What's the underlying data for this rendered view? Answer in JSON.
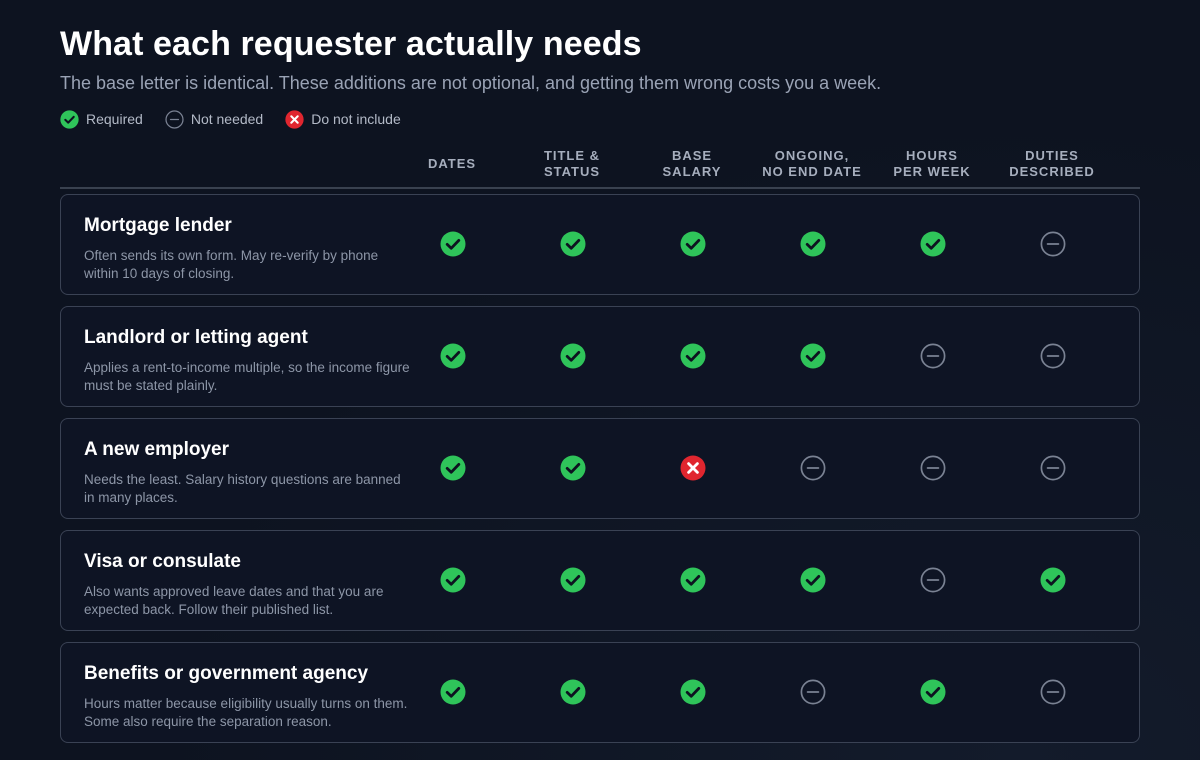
{
  "title": "What each requester actually needs",
  "subtitle": "The base letter is identical. These additions are not optional, and getting them wrong costs you a week.",
  "legend": [
    {
      "status": "required",
      "icon": "check-circle-icon",
      "label": "Required"
    },
    {
      "status": "not_needed",
      "icon": "minus-circle-icon",
      "label": "Not needed"
    },
    {
      "status": "do_not_include",
      "icon": "x-circle-icon",
      "label": "Do not include"
    }
  ],
  "colors": {
    "required": "#2fc45a",
    "not_needed": "#7a8293",
    "do_not_include": "#e0262f"
  },
  "columns": [
    {
      "label": "DATES"
    },
    {
      "label": "TITLE &\nSTATUS"
    },
    {
      "label": "BASE\nSALARY"
    },
    {
      "label": "ONGOING,\nNO END DATE"
    },
    {
      "label": "HOURS\nPER WEEK"
    },
    {
      "label": "DUTIES\nDESCRIBED"
    }
  ],
  "rows": [
    {
      "name": "Mortgage lender",
      "description": "Often sends its own form. May re-verify by phone within 10 days of closing.",
      "cells": [
        "required",
        "required",
        "required",
        "required",
        "required",
        "not_needed"
      ]
    },
    {
      "name": "Landlord or letting agent",
      "description": "Applies a rent-to-income multiple, so the income figure must be stated plainly.",
      "cells": [
        "required",
        "required",
        "required",
        "required",
        "not_needed",
        "not_needed"
      ]
    },
    {
      "name": "A new employer",
      "description": "Needs the least. Salary history questions are banned in many places.",
      "cells": [
        "required",
        "required",
        "do_not_include",
        "not_needed",
        "not_needed",
        "not_needed"
      ]
    },
    {
      "name": "Visa or consulate",
      "description": "Also wants approved leave dates and that you are expected back. Follow their published list.",
      "cells": [
        "required",
        "required",
        "required",
        "required",
        "not_needed",
        "required"
      ]
    },
    {
      "name": "Benefits or government agency",
      "description": "Hours matter because eligibility usually turns on them. Some also require the separation reason.",
      "cells": [
        "required",
        "required",
        "required",
        "not_needed",
        "required",
        "not_needed"
      ]
    }
  ]
}
